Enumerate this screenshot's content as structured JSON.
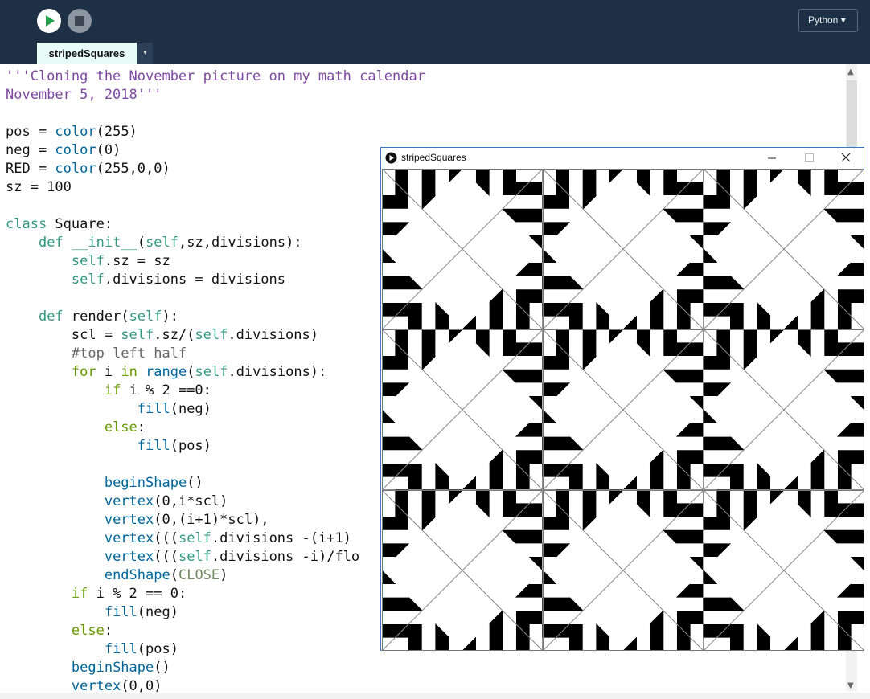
{
  "toolbar": {
    "run_icon": "play-icon",
    "stop_icon": "stop-icon",
    "mode_label": "Python ▾"
  },
  "tabs": {
    "active_label": "stripedSquares",
    "menu_glyph": "▾"
  },
  "editor": {
    "lines": [
      [
        {
          "t": "'''Cloning the November picture on my math calendar",
          "c": "#7d4aa0"
        }
      ],
      [
        {
          "t": "November 5, 2018'''",
          "c": "#7d4aa0"
        }
      ],
      [],
      [
        {
          "t": "pos = ",
          "c": "#111"
        },
        {
          "t": "color",
          "c": "#006699"
        },
        {
          "t": "(255)",
          "c": "#111"
        }
      ],
      [
        {
          "t": "neg = ",
          "c": "#111"
        },
        {
          "t": "color",
          "c": "#006699"
        },
        {
          "t": "(0)",
          "c": "#111"
        }
      ],
      [
        {
          "t": "RED = ",
          "c": "#111"
        },
        {
          "t": "color",
          "c": "#006699"
        },
        {
          "t": "(255,0,0)",
          "c": "#111"
        }
      ],
      [
        {
          "t": "sz = 100",
          "c": "#111"
        }
      ],
      [],
      [
        {
          "t": "class",
          "c": "#33997e"
        },
        {
          "t": " Square:",
          "c": "#111"
        }
      ],
      [
        {
          "t": "    ",
          "c": "#111"
        },
        {
          "t": "def",
          "c": "#33997e"
        },
        {
          "t": " ",
          "c": "#111"
        },
        {
          "t": "__init__",
          "c": "#33997e"
        },
        {
          "t": "(",
          "c": "#111"
        },
        {
          "t": "self",
          "c": "#33997e"
        },
        {
          "t": ",sz,divisions):",
          "c": "#111"
        }
      ],
      [
        {
          "t": "        ",
          "c": "#111"
        },
        {
          "t": "self",
          "c": "#33997e"
        },
        {
          "t": ".sz = sz",
          "c": "#111"
        }
      ],
      [
        {
          "t": "        ",
          "c": "#111"
        },
        {
          "t": "self",
          "c": "#33997e"
        },
        {
          "t": ".divisions = divisions",
          "c": "#111"
        }
      ],
      [],
      [
        {
          "t": "    ",
          "c": "#111"
        },
        {
          "t": "def",
          "c": "#33997e"
        },
        {
          "t": " render(",
          "c": "#111"
        },
        {
          "t": "self",
          "c": "#33997e"
        },
        {
          "t": "):",
          "c": "#111"
        }
      ],
      [
        {
          "t": "        scl = ",
          "c": "#111"
        },
        {
          "t": "self",
          "c": "#33997e"
        },
        {
          "t": ".sz/(",
          "c": "#111"
        },
        {
          "t": "self",
          "c": "#33997e"
        },
        {
          "t": ".divisions)",
          "c": "#111"
        }
      ],
      [
        {
          "t": "        #top left half",
          "c": "#666666"
        }
      ],
      [
        {
          "t": "        ",
          "c": "#111"
        },
        {
          "t": "for",
          "c": "#669900"
        },
        {
          "t": " i ",
          "c": "#111"
        },
        {
          "t": "in",
          "c": "#669900"
        },
        {
          "t": " ",
          "c": "#111"
        },
        {
          "t": "range",
          "c": "#006699"
        },
        {
          "t": "(",
          "c": "#111"
        },
        {
          "t": "self",
          "c": "#33997e"
        },
        {
          "t": ".divisions):",
          "c": "#111"
        }
      ],
      [
        {
          "t": "            ",
          "c": "#111"
        },
        {
          "t": "if",
          "c": "#669900"
        },
        {
          "t": " i % 2 ==0:",
          "c": "#111"
        }
      ],
      [
        {
          "t": "                ",
          "c": "#111"
        },
        {
          "t": "fill",
          "c": "#006699"
        },
        {
          "t": "(neg)",
          "c": "#111"
        }
      ],
      [
        {
          "t": "            ",
          "c": "#111"
        },
        {
          "t": "else",
          "c": "#669900"
        },
        {
          "t": ":",
          "c": "#111"
        }
      ],
      [
        {
          "t": "                ",
          "c": "#111"
        },
        {
          "t": "fill",
          "c": "#006699"
        },
        {
          "t": "(pos)",
          "c": "#111"
        }
      ],
      [],
      [
        {
          "t": "            ",
          "c": "#111"
        },
        {
          "t": "beginShape",
          "c": "#006699"
        },
        {
          "t": "()",
          "c": "#111"
        }
      ],
      [
        {
          "t": "            ",
          "c": "#111"
        },
        {
          "t": "vertex",
          "c": "#006699"
        },
        {
          "t": "(0,i*scl)",
          "c": "#111"
        }
      ],
      [
        {
          "t": "            ",
          "c": "#111"
        },
        {
          "t": "vertex",
          "c": "#006699"
        },
        {
          "t": "(0,(i+1)*scl),",
          "c": "#111"
        }
      ],
      [
        {
          "t": "            ",
          "c": "#111"
        },
        {
          "t": "vertex",
          "c": "#006699"
        },
        {
          "t": "(((",
          "c": "#111"
        },
        {
          "t": "self",
          "c": "#33997e"
        },
        {
          "t": ".divisions -(i+1)",
          "c": "#111"
        }
      ],
      [
        {
          "t": "            ",
          "c": "#111"
        },
        {
          "t": "vertex",
          "c": "#006699"
        },
        {
          "t": "(((",
          "c": "#111"
        },
        {
          "t": "self",
          "c": "#33997e"
        },
        {
          "t": ".divisions -i)/flo",
          "c": "#111"
        }
      ],
      [
        {
          "t": "            ",
          "c": "#111"
        },
        {
          "t": "endShape",
          "c": "#006699"
        },
        {
          "t": "(",
          "c": "#111"
        },
        {
          "t": "CLOSE",
          "c": "#718a62"
        },
        {
          "t": ")",
          "c": "#111"
        }
      ],
      [
        {
          "t": "        ",
          "c": "#111"
        },
        {
          "t": "if",
          "c": "#669900"
        },
        {
          "t": " i % 2 == 0:",
          "c": "#111"
        }
      ],
      [
        {
          "t": "            ",
          "c": "#111"
        },
        {
          "t": "fill",
          "c": "#006699"
        },
        {
          "t": "(neg)",
          "c": "#111"
        }
      ],
      [
        {
          "t": "        ",
          "c": "#111"
        },
        {
          "t": "else",
          "c": "#669900"
        },
        {
          "t": ":",
          "c": "#111"
        }
      ],
      [
        {
          "t": "            ",
          "c": "#111"
        },
        {
          "t": "fill",
          "c": "#006699"
        },
        {
          "t": "(pos)",
          "c": "#111"
        }
      ],
      [
        {
          "t": "        ",
          "c": "#111"
        },
        {
          "t": "beginShape",
          "c": "#006699"
        },
        {
          "t": "()",
          "c": "#111"
        }
      ],
      [
        {
          "t": "        ",
          "c": "#111"
        },
        {
          "t": "vertex",
          "c": "#006699"
        },
        {
          "t": "(0,0)",
          "c": "#111"
        }
      ]
    ]
  },
  "sketch_window": {
    "title": "stripedSquares",
    "minimize_glyph": "—",
    "maximize_glyph": "☐",
    "close_glyph": "✕",
    "pattern": {
      "grid_rows": 3,
      "grid_cols": 3,
      "divisions": 6,
      "positive_color": "#ffffff",
      "negative_color": "#000000"
    }
  },
  "colors": {
    "toolbar_bg": "#1d3045",
    "tab_bg": "#e9fbf7",
    "window_border": "#3a78c4"
  }
}
